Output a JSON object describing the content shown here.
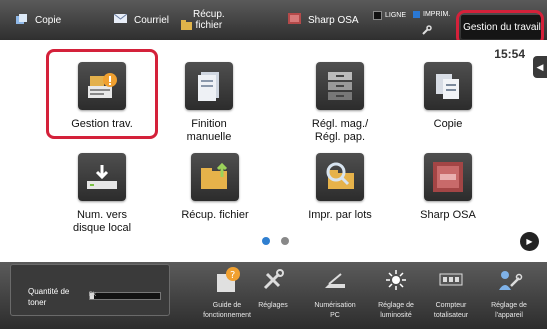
{
  "topbar": {
    "copy_label": "Copie",
    "mail_label": "Courriel",
    "recup_label_1": "Récup.",
    "recup_label_2": "fichier",
    "sharp_label": "Sharp OSA",
    "ligne_label": "LIGNE",
    "imprim_label": "IMPRIM.",
    "gestion_label": "Gestion du travail"
  },
  "clock": "15:54",
  "apps": [
    {
      "label1": "Gestion trav.",
      "label2": ""
    },
    {
      "label1": "Finition",
      "label2": "manuelle"
    },
    {
      "label1": "Régl. mag./",
      "label2": "Régl. pap."
    },
    {
      "label1": "Copie",
      "label2": ""
    },
    {
      "label1": "Num. vers",
      "label2": "disque local"
    },
    {
      "label1": "Récup. fichier",
      "label2": ""
    },
    {
      "label1": "Impr. par lots",
      "label2": ""
    },
    {
      "label1": "Sharp OSA",
      "label2": ""
    }
  ],
  "bottom": {
    "toner_label_1": "Quantité de",
    "toner_label_2": "toner",
    "toner_k": "Bk",
    "toner_level": 0.05,
    "items": [
      {
        "l1": "Guide de",
        "l2": "fonctionnement"
      },
      {
        "l1": "Réglages",
        "l2": ""
      },
      {
        "l1": "Numérisation",
        "l2": "PC"
      },
      {
        "l1": "Réglage de",
        "l2": "luminosité"
      },
      {
        "l1": "Compteur",
        "l2": "totalisateur"
      },
      {
        "l1": "Réglage de",
        "l2": "l'appareil"
      }
    ]
  },
  "colors": {
    "highlight": "#d4213a",
    "accent_dot": "#2f7fd0",
    "status_blue": "#2a78d4"
  }
}
